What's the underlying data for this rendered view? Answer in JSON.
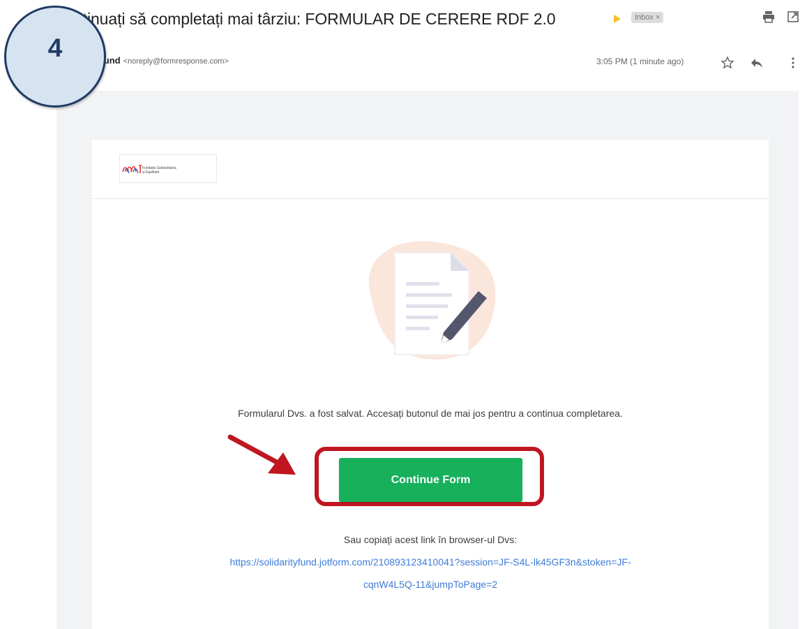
{
  "step": {
    "number": "4"
  },
  "header": {
    "subject": "ntinuați să completați mai târziu: FORMULAR DE CERERE RDF 2.0",
    "label_badge": "Inbox ×",
    "icons": [
      "print-icon",
      "open-in-new-window-icon"
    ]
  },
  "sender": {
    "name": "rity Fund",
    "email": "<noreply@formresponse.com>",
    "timestamp": "3:05 PM (1 minute ago)",
    "icons": [
      "star-icon",
      "reply-icon",
      "more-vert-icon"
    ]
  },
  "email": {
    "logo_text_line1": "Fundația Solidaritatea",
    "logo_text_line2": "și Egalitate",
    "message": "Formularul Dvs. a fost salvat. Accesați butonul de mai jos pentru a continua completarea.",
    "button_label": "Continue Form",
    "copy_label": "Sau copiați acest link în browser-ul Dvs:",
    "link_line1": "https://solidarityfund.jotform.com/210893123410041?session=JF-S4L-lk45GF3n&stoken=JF-",
    "link_line2": "cqnW4L5Q-11&jumpToPage=2"
  },
  "colors": {
    "accent_button": "#17b05b",
    "callout": "#c01621",
    "link": "#3d7bd6",
    "step_circle_fill": "#d6e3f1",
    "step_circle_border": "#1f3b63"
  }
}
